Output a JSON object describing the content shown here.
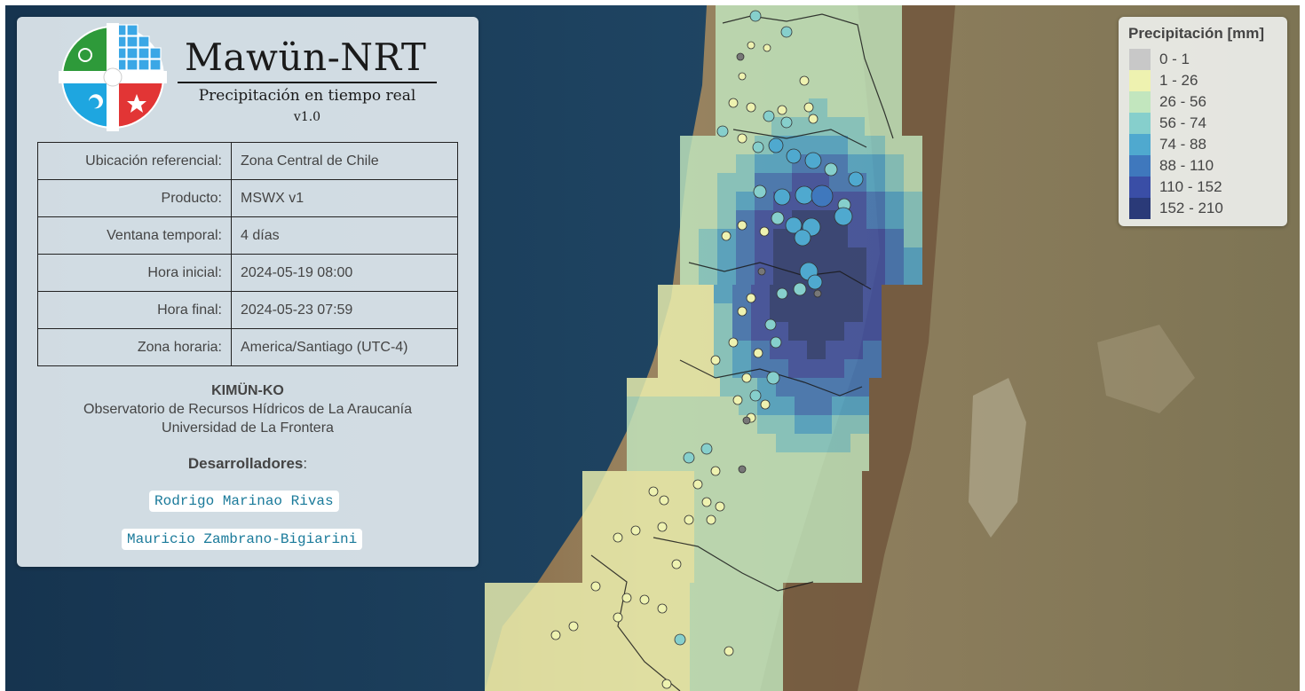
{
  "app": {
    "title": "Mawün-NRT",
    "subtitle": "Precipitación en tiempo real",
    "version": "v1.0"
  },
  "info_table": [
    {
      "label": "Ubicación referencial:",
      "value": "Zona Central de Chile"
    },
    {
      "label": "Producto:",
      "value": "MSWX v1"
    },
    {
      "label": "Ventana temporal:",
      "value": "4 días"
    },
    {
      "label": "Hora inicial:",
      "value": "2024-05-19 08:00"
    },
    {
      "label": "Hora final:",
      "value": "2024-05-23 07:59"
    },
    {
      "label": "Zona horaria:",
      "value": "America/Santiago (UTC-4)"
    }
  ],
  "organization": {
    "name": "KIMÜN-KO",
    "line1": "Observatorio de Recursos Hídricos de La Araucanía",
    "line2": "Universidad de La Frontera"
  },
  "developers": {
    "heading": "Desarrolladores",
    "names": [
      "Rodrigo Marinao Rivas",
      "Mauricio Zambrano-Bigiarini"
    ]
  },
  "legend": {
    "title": "Precipitación [mm]",
    "items": [
      {
        "label": "0 - 1",
        "color": "#c8c8c8"
      },
      {
        "label": "1 - 26",
        "color": "#eef2b0"
      },
      {
        "label": "26 - 56",
        "color": "#c2e6be"
      },
      {
        "label": "56 - 74",
        "color": "#86cfcc"
      },
      {
        "label": "74 - 88",
        "color": "#4fa9cf"
      },
      {
        "label": "88 - 110",
        "color": "#3f78bd"
      },
      {
        "label": "110 - 152",
        "color": "#3a4ea6"
      },
      {
        "label": "152 - 210",
        "color": "#2a3a78"
      }
    ]
  },
  "map_colors": {
    "ocean": "#1f4060",
    "land": "#8c7a58",
    "andes": "#6e5238"
  }
}
